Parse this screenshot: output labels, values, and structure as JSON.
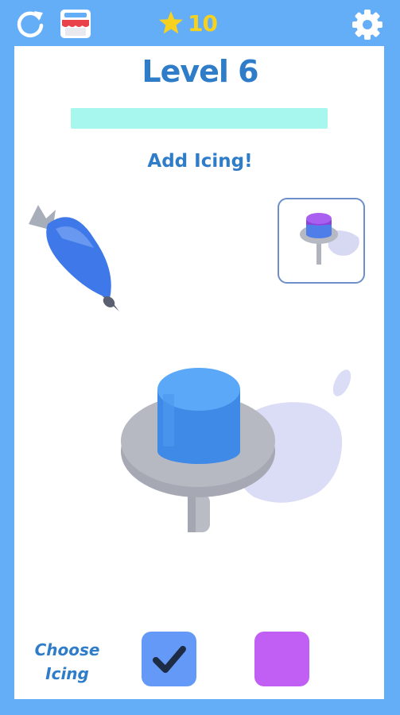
{
  "header": {
    "star_count": "10",
    "icons": [
      "restart-icon",
      "shop-icon",
      "star-icon",
      "settings-icon"
    ]
  },
  "level": {
    "title": "Level 6",
    "progress_fraction": 0.0,
    "instruction": "Add Icing!"
  },
  "footer": {
    "choose_label_line1": "Choose",
    "choose_label_line2": "Icing",
    "swatches": [
      {
        "name": "blue",
        "color": "#6599f7",
        "selected": true
      },
      {
        "name": "purple",
        "color": "#c15ff4",
        "selected": false
      }
    ]
  },
  "colors": {
    "background": "#63aef6",
    "panel": "#ffffff",
    "title": "#2f7dc9",
    "star": "#f7d11f",
    "progress": "#a7f7ef",
    "cake": "#4a96ec",
    "turntable": "#b1b4bd"
  }
}
